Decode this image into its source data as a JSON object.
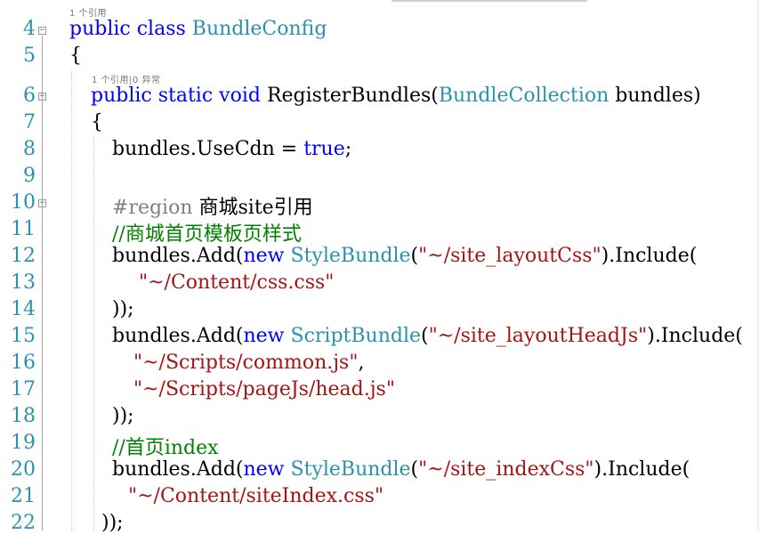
{
  "editor": {
    "lines": [
      {
        "n": "4",
        "tokens": [
          {
            "t": "public class ",
            "c": "kw"
          },
          {
            "t": "BundleConfig",
            "c": "ty"
          }
        ]
      },
      {
        "n": "5",
        "tokens": [
          {
            "t": "{",
            "c": ""
          }
        ]
      },
      {
        "n": "6",
        "tokens": [
          {
            "t": "public static void ",
            "c": "kw"
          },
          {
            "t": "RegisterBundles(",
            "c": ""
          },
          {
            "t": "BundleCollection",
            "c": "ty"
          },
          {
            "t": " bundles)",
            "c": ""
          }
        ]
      },
      {
        "n": "7",
        "tokens": [
          {
            "t": "{",
            "c": ""
          }
        ]
      },
      {
        "n": "8",
        "tokens": [
          {
            "t": "bundles.UseCdn = ",
            "c": ""
          },
          {
            "t": "true",
            "c": "kw"
          },
          {
            "t": ";",
            "c": ""
          }
        ]
      },
      {
        "n": "9",
        "tokens": []
      },
      {
        "n": "10",
        "tokens": [
          {
            "t": "#region ",
            "c": "rg"
          },
          {
            "t": "商城site引用",
            "c": ""
          }
        ]
      },
      {
        "n": "11",
        "tokens": [
          {
            "t": "//商城首页模板页样式",
            "c": "cm"
          }
        ]
      },
      {
        "n": "12",
        "tokens": [
          {
            "t": "bundles.Add(",
            "c": ""
          },
          {
            "t": "new ",
            "c": "kw"
          },
          {
            "t": "StyleBundle",
            "c": "ty"
          },
          {
            "t": "(",
            "c": ""
          },
          {
            "t": "\"~/site_layoutCss\"",
            "c": "str"
          },
          {
            "t": ").Include(",
            "c": ""
          }
        ]
      },
      {
        "n": "13",
        "tokens": [
          {
            "t": "\"~/Content/css.css\"",
            "c": "str"
          }
        ]
      },
      {
        "n": "14",
        "tokens": [
          {
            "t": "));",
            "c": ""
          }
        ]
      },
      {
        "n": "15",
        "tokens": [
          {
            "t": "bundles.Add(",
            "c": ""
          },
          {
            "t": "new ",
            "c": "kw"
          },
          {
            "t": "ScriptBundle",
            "c": "ty"
          },
          {
            "t": "(",
            "c": ""
          },
          {
            "t": "\"~/site_layoutHeadJs\"",
            "c": "str"
          },
          {
            "t": ").Include(",
            "c": ""
          }
        ]
      },
      {
        "n": "16",
        "tokens": [
          {
            "t": "\"~/Scripts/common.js\"",
            "c": "str"
          },
          {
            "t": ",",
            "c": ""
          }
        ]
      },
      {
        "n": "17",
        "tokens": [
          {
            "t": "\"~/Scripts/pageJs/head.js\"",
            "c": "str"
          }
        ]
      },
      {
        "n": "18",
        "tokens": [
          {
            "t": "));",
            "c": ""
          }
        ]
      },
      {
        "n": "19",
        "tokens": [
          {
            "t": "//首页index",
            "c": "cm"
          }
        ]
      },
      {
        "n": "20",
        "tokens": [
          {
            "t": "bundles.Add(",
            "c": ""
          },
          {
            "t": "new ",
            "c": "kw"
          },
          {
            "t": "StyleBundle",
            "c": "ty"
          },
          {
            "t": "(",
            "c": ""
          },
          {
            "t": "\"~/site_indexCss\"",
            "c": "str"
          },
          {
            "t": ").Include(",
            "c": ""
          }
        ]
      },
      {
        "n": "21",
        "tokens": [
          {
            "t": "\"~/Content/siteIndex.css\"",
            "c": "str"
          }
        ]
      },
      {
        "n": "22",
        "tokens": [
          {
            "t": "));",
            "c": ""
          }
        ]
      }
    ],
    "codelens": [
      {
        "text": "1 个引用"
      },
      {
        "text": "1 个引用|0 异常"
      }
    ]
  }
}
